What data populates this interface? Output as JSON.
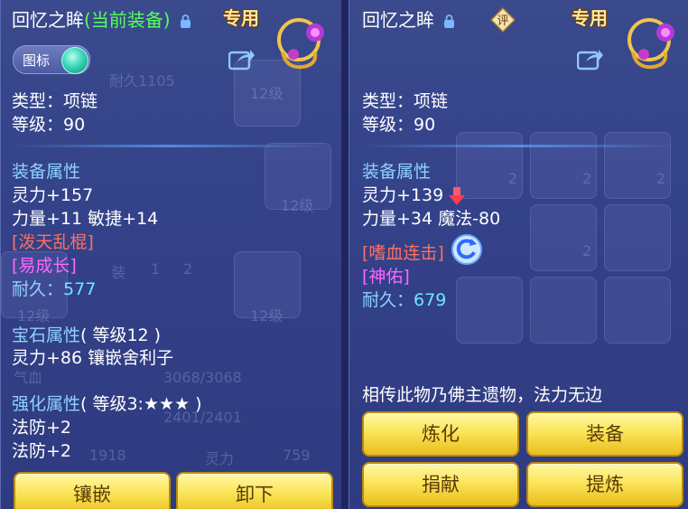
{
  "left": {
    "title": "回忆之眸",
    "title_sub": "(当前装备)",
    "exclusive": "专用",
    "toggle_label": "图标",
    "type": "类型：项链",
    "level": "等级：90",
    "attr_header": "装备属性",
    "attr_lines": [
      "灵力+157",
      "力量+11 敏捷+14"
    ],
    "specials": [
      "[泼天乱棍]",
      "[易成长]"
    ],
    "durability_label": "耐久：",
    "durability_value": "577",
    "gem_header": "宝石属性",
    "gem_level": "( 等级12 )",
    "gem_line": "灵力+86 镶嵌舍利子",
    "enhance_header": "强化属性",
    "enhance_level": "( 等级3:★★★ )",
    "enhance_lines": [
      "法防+2",
      "法防+2"
    ],
    "buttons": [
      "镶嵌",
      "卸下"
    ],
    "background": {
      "tile_texts": [
        "12级",
        "12级",
        "12级",
        "12级",
        "耐久1105",
        "气血",
        "3068/3068",
        "2401/2401",
        "1918",
        "灵力",
        "759",
        "装",
        "1",
        "2"
      ]
    }
  },
  "right": {
    "title": "回忆之眸",
    "appraise_label": "评",
    "exclusive": "专用",
    "type": "类型：项链",
    "level": "等级：90",
    "attr_header": "装备属性",
    "attr_lines": [
      "灵力+139",
      "力量+34 魔法-80"
    ],
    "specials": [
      "[嗜血连击]",
      "[神佑]"
    ],
    "durability_label": "耐久：",
    "durability_value": "679",
    "description": "相传此物乃佛主遗物，法力无边",
    "buttons": [
      "炼化",
      "装备",
      "捐献",
      "提炼"
    ],
    "background": {
      "tile_texts": [
        "2",
        "2",
        "2",
        "2"
      ]
    }
  },
  "colors": {
    "panel_bg": "#34428a",
    "label_blue": "#8fd2ff",
    "special_red": "#ff7060",
    "special_magenta": "#ff66ff",
    "durability_cyan": "#6ee6ff",
    "current_green": "#56ff5c",
    "button_gold": "#fbe55a"
  },
  "icons": [
    "lock-icon",
    "share-icon",
    "necklace-icon",
    "appraise-icon",
    "down-arrow-icon",
    "skill-icon",
    "toggle-switch"
  ]
}
